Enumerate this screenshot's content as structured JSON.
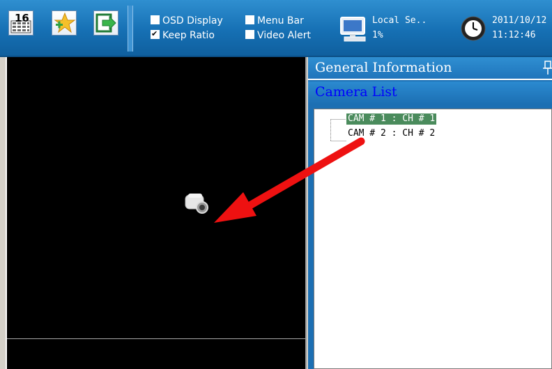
{
  "toolbar": {
    "buttons": [
      {
        "name": "layout-16-button",
        "icon": "grid-16-icon",
        "label": "16"
      },
      {
        "name": "favorite-add-button",
        "icon": "star-plus-icon"
      },
      {
        "name": "exit-button",
        "icon": "exit-arrow-icon"
      }
    ],
    "options": {
      "osd_display": {
        "label": "OSD Display",
        "checked": false
      },
      "keep_ratio": {
        "label": "Keep Ratio",
        "checked": true
      },
      "menu_bar": {
        "label": "Menu Bar",
        "checked": false
      },
      "video_alert": {
        "label": "Video Alert",
        "checked": false
      }
    },
    "status": {
      "site": "Local Se..",
      "usage": "1%",
      "date": "2011/10/12",
      "time": "11:12:46"
    }
  },
  "panel": {
    "general_info": "General Information",
    "camera_list": "Camera List",
    "cameras": [
      {
        "label": "CAM # 1 : CH # 1",
        "selected": true
      },
      {
        "label": "CAM # 2 : CH # 2",
        "selected": false
      }
    ]
  },
  "colors": {
    "toolbar": "#1670b4",
    "panel_header_text": "#ffffff",
    "camera_list_text": "#0000ff",
    "selection": "#4a8b5c",
    "annotation_arrow": "#ee1111"
  }
}
